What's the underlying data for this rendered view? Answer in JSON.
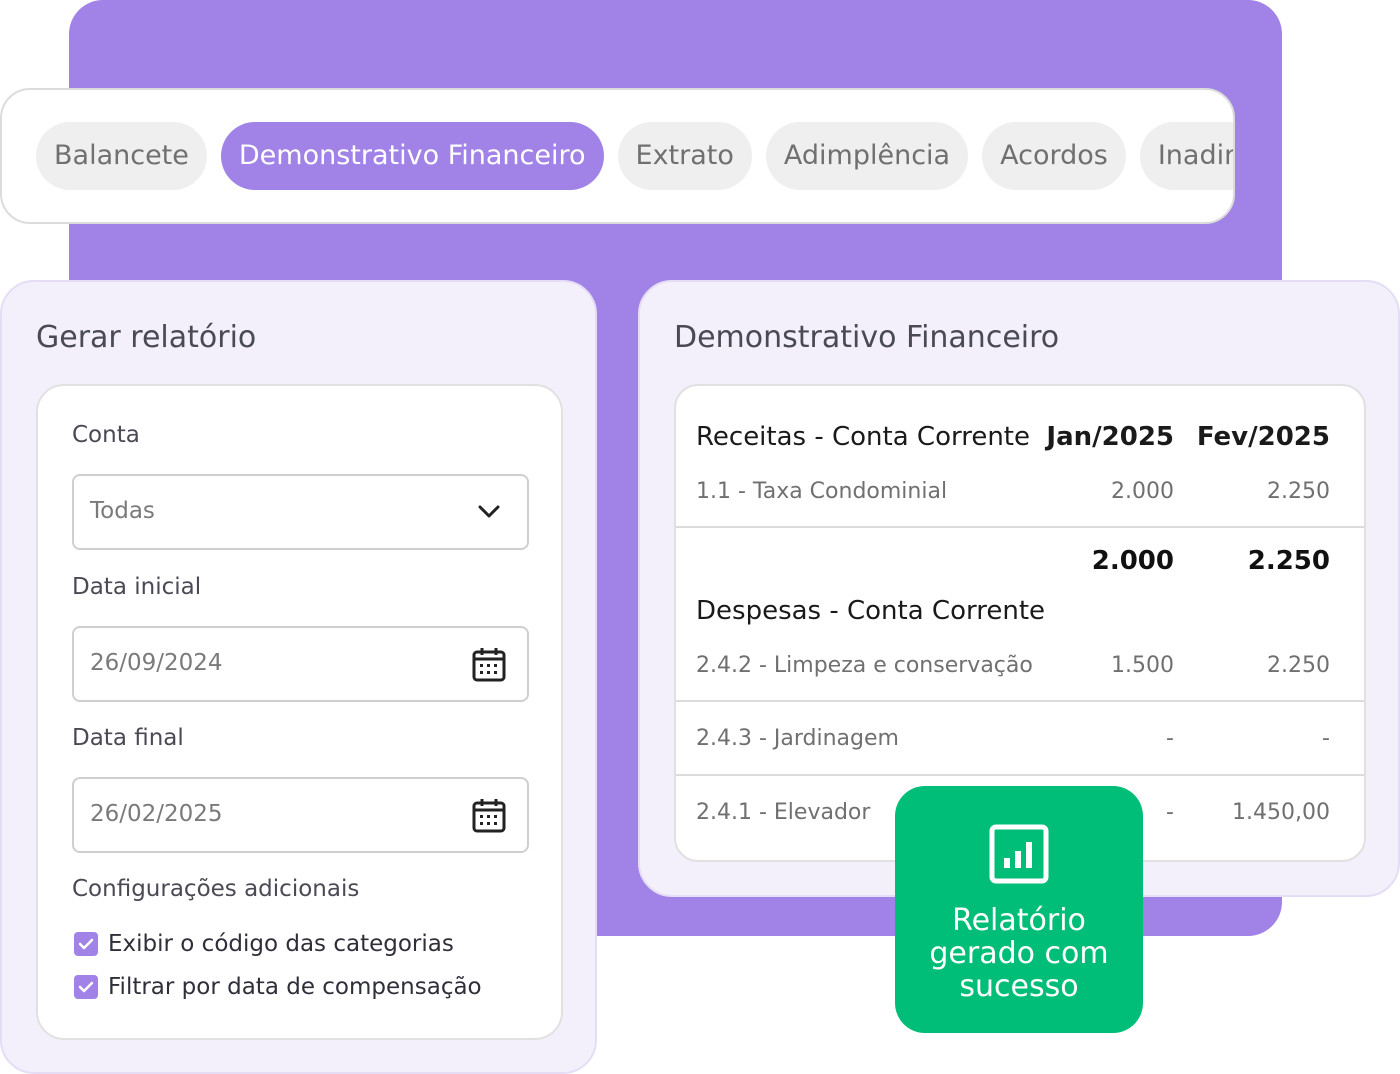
{
  "tabs": [
    {
      "label": "Balancete",
      "active": false
    },
    {
      "label": "Demonstrativo Financeiro",
      "active": true
    },
    {
      "label": "Extrato",
      "active": false
    },
    {
      "label": "Adimplência",
      "active": false
    },
    {
      "label": "Acordos",
      "active": false
    },
    {
      "label": "Inadimplência",
      "active": false
    }
  ],
  "generate": {
    "title": "Gerar relatório",
    "account_label": "Conta",
    "account_value": "Todas",
    "start_label": "Data inicial",
    "start_value": "26/09/2024",
    "end_label": "Data final",
    "end_value": "26/02/2025",
    "extra_label": "Configurações adicionais",
    "options": [
      {
        "label": "Exibir o código das categorias",
        "checked": true
      },
      {
        "label": "Filtrar por data de compensação",
        "checked": true
      }
    ]
  },
  "report": {
    "title": "Demonstrativo Financeiro",
    "receitas_header": "Receitas - Conta Corrente",
    "col1": "Jan/2025",
    "col2": "Fev/2025",
    "receitas_rows": [
      {
        "label": "1.1 - Taxa Condominial",
        "jan": "2.000",
        "fev": "2.250"
      }
    ],
    "receitas_total": {
      "jan": "2.000",
      "fev": "2.250"
    },
    "despesas_header": "Despesas - Conta Corrente",
    "despesas_rows": [
      {
        "label": "2.4.2 - Limpeza e conservação",
        "jan": "1.500",
        "fev": "2.250"
      },
      {
        "label": "2.4.3 - Jardinagem",
        "jan": "-",
        "fev": "-"
      },
      {
        "label": "2.4.1 - Elevador",
        "jan": "-",
        "fev": "1.450,00"
      }
    ]
  },
  "toast": {
    "icon": "bar-chart-icon",
    "message": "Relatório gerado com sucesso"
  },
  "colors": {
    "accent": "#a182e6",
    "success": "#00bd77",
    "card_bg": "#f3f0fc"
  }
}
